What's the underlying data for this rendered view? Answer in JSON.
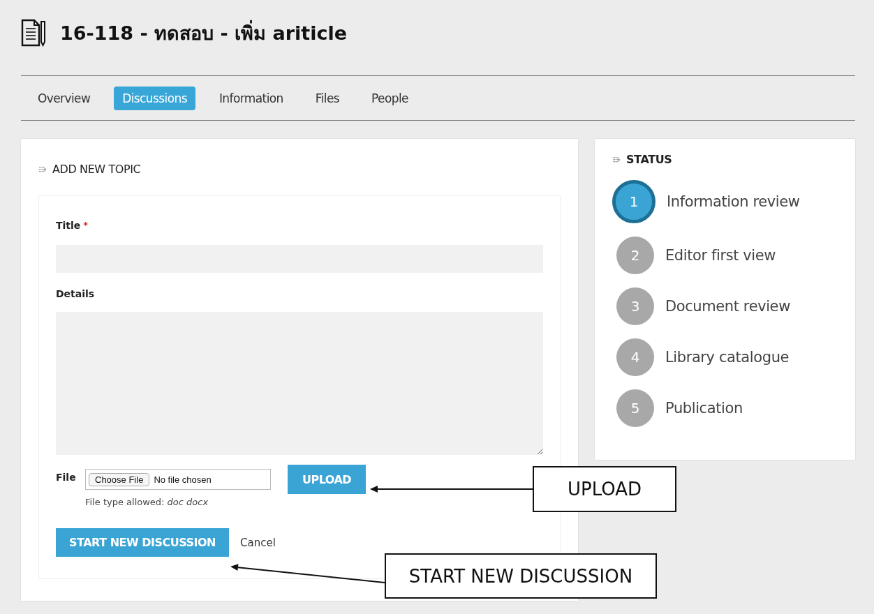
{
  "page": {
    "title": "16-118 - ทดสอบ - เพิ่ม ariticle"
  },
  "tabs": [
    {
      "label": "Overview",
      "selected": false
    },
    {
      "label": "Discussions",
      "selected": true
    },
    {
      "label": "Information",
      "selected": false
    },
    {
      "label": "Files",
      "selected": false
    },
    {
      "label": "People",
      "selected": false
    }
  ],
  "topic_form": {
    "heading": "ADD NEW TOPIC",
    "title_label": "Title",
    "required_mark": "*",
    "details_label": "Details",
    "file_label": "File",
    "file_button": "Choose File",
    "file_status": "No file chosen",
    "upload_button": "UPLOAD",
    "file_hint": "File type allowed: *doc docx*",
    "submit_button": "START NEW DISCUSSION",
    "cancel_link": "Cancel"
  },
  "status": {
    "heading": "STATUS",
    "steps": [
      {
        "number": "1",
        "label": "Information review",
        "active": true
      },
      {
        "number": "2",
        "label": "Editor first view",
        "active": false
      },
      {
        "number": "3",
        "label": "Document review",
        "active": false
      },
      {
        "number": "4",
        "label": "Library catalogue",
        "active": false
      },
      {
        "number": "5",
        "label": "Publication",
        "active": false
      }
    ]
  },
  "callouts": [
    {
      "text": "UPLOAD"
    },
    {
      "text": "START NEW DISCUSSION"
    }
  ]
}
